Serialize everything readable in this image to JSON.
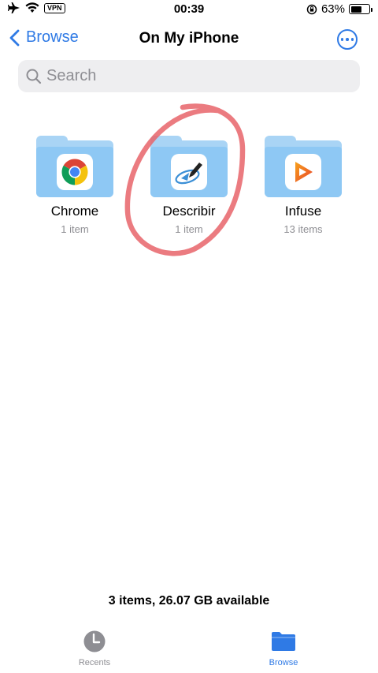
{
  "status_bar": {
    "vpn_label": "VPN",
    "time": "00:39",
    "battery_percent": "63%",
    "battery_level": 0.63
  },
  "nav": {
    "back_label": "Browse",
    "title": "On My iPhone"
  },
  "search": {
    "placeholder": "Search",
    "value": ""
  },
  "folders": [
    {
      "name": "Chrome",
      "count": "1 item",
      "app_icon": "chrome-icon"
    },
    {
      "name": "Describir",
      "count": "1 item",
      "app_icon": "describir-icon"
    },
    {
      "name": "Infuse",
      "count": "13 items",
      "app_icon": "infuse-icon"
    }
  ],
  "footer": {
    "storage_info": "3 items, 26.07 GB available"
  },
  "tabbar": {
    "recents_label": "Recents",
    "browse_label": "Browse"
  },
  "colors": {
    "accent": "#2f7ae5",
    "folder_light": "#a9d4f5",
    "folder_front": "#8ec8f4",
    "annotation": "#e8646a",
    "inactive": "#8e8e93"
  }
}
